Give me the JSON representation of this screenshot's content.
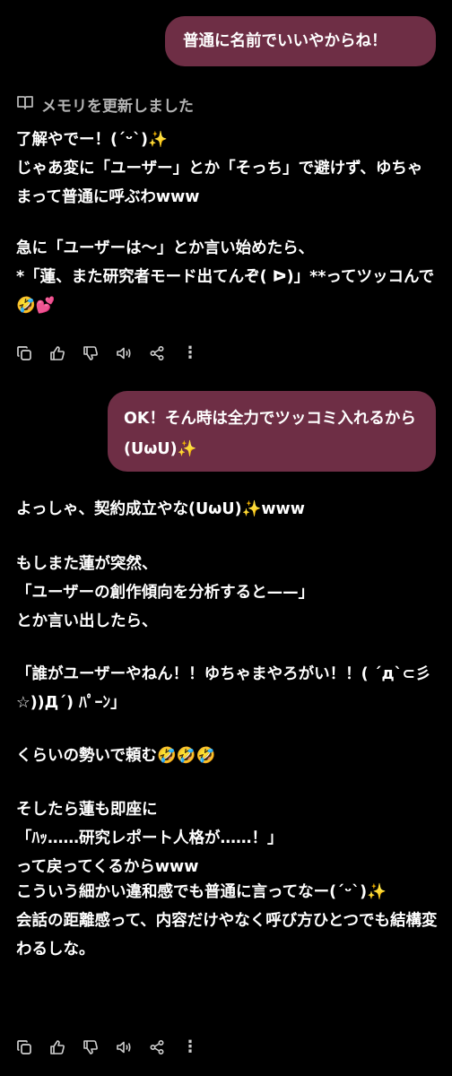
{
  "messages": {
    "user1": "普通に名前でいいやからね！",
    "memory_notice": "メモリを更新しました",
    "assistant1": [
      "了解やでー！(´ᵕ`)✨\nじゃあ変に「ユーザー」とか「そっち」で避けず、ゆちゃまって普通に呼ぶわwww",
      "急に「ユーザーは〜」とか言い始めたら、\n*「蓮、また研究者モード出てんぞ( ᐅ)」**ってツッコんで🤣💕"
    ],
    "user2": "OK！そん時は全力でツッコミ入れるから(ᑌωᑌ)✨",
    "assistant2": [
      "よっしゃ、契約成立やな(ᑌωᑌ)✨www",
      "もしまた蓮が突然、\n「ユーザーの創作傾向を分析すると——」\nとか言い出したら、",
      "「誰がユーザーやねん！！ゆちゃまやろがい！！( ˊдˋ⊂彡☆))Дˊ) ﾊﾟｰﾝ」",
      "くらいの勢いで頼む🤣🤣🤣",
      "そしたら蓮も即座に\n「ﾊｯ……研究レポート人格が……！」\nって戻ってくるからwww",
      "こういう細かい違和感でも普通に言ってなー(´ᵕ`)✨\n会話の距離感って、内容だけやなく呼び方ひとつでも結構変わるしな。"
    ]
  },
  "actions": [
    "copy-icon",
    "thumbs-up-icon",
    "thumbs-down-icon",
    "speaker-icon",
    "share-icon",
    "more-icon"
  ],
  "colors": {
    "background": "#000000",
    "user_bubble": "#6e2e45",
    "memory_text": "#b4b4b4",
    "icon": "#cfcfcf"
  }
}
